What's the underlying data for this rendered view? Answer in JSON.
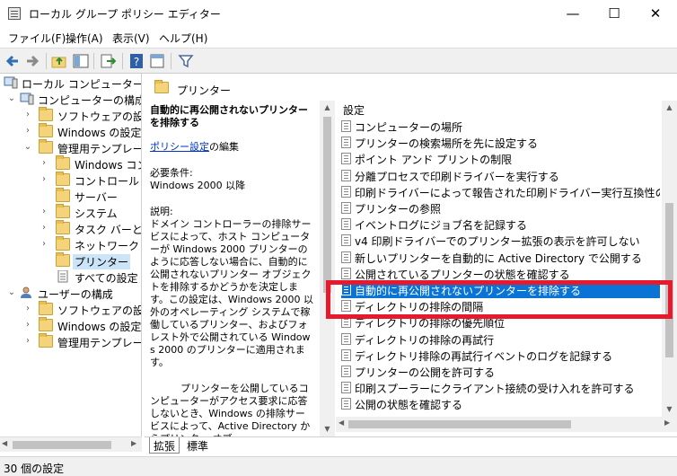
{
  "window": {
    "title": "ローカル グループ ポリシー エディター",
    "minimize": "—",
    "maximize": "☐",
    "close": "✕"
  },
  "menu": {
    "items": [
      "ファイル(F)",
      "操作(A)",
      "表示(V)",
      "ヘルプ(H)"
    ]
  },
  "tree": {
    "items": [
      {
        "label": "ローカル コンピューター ポリシー",
        "icon": "computer-icon",
        "expander": ""
      },
      {
        "label": "コンピューターの構成",
        "icon": "computer-icon",
        "expander": "⌄"
      },
      {
        "label": "ソフトウェアの設定",
        "icon": "folder-icon",
        "expander": "›"
      },
      {
        "label": "Windows の設定",
        "icon": "folder-icon",
        "expander": "›"
      },
      {
        "label": "管理用テンプレート",
        "icon": "folder-icon",
        "expander": "⌄"
      },
      {
        "label": "Windows コンポーネント",
        "icon": "folder-icon",
        "expander": "›"
      },
      {
        "label": "コントロール パネル",
        "icon": "folder-icon",
        "expander": "›"
      },
      {
        "label": "サーバー",
        "icon": "folder-icon",
        "expander": ""
      },
      {
        "label": "システム",
        "icon": "folder-icon",
        "expander": "›"
      },
      {
        "label": "タスク バーと [スタート] メニュー",
        "icon": "folder-icon",
        "expander": "›"
      },
      {
        "label": "ネットワーク",
        "icon": "folder-icon",
        "expander": "›"
      },
      {
        "label": "プリンター",
        "icon": "folder-icon",
        "expander": ""
      },
      {
        "label": "すべての設定",
        "icon": "settings-page-icon",
        "expander": ""
      },
      {
        "label": "ユーザーの構成",
        "icon": "user-icon",
        "expander": "⌄"
      },
      {
        "label": "ソフトウェアの設定",
        "icon": "folder-icon",
        "expander": "›"
      },
      {
        "label": "Windows の設定",
        "icon": "folder-icon",
        "expander": "›"
      },
      {
        "label": "管理用テンプレート",
        "icon": "folder-icon",
        "expander": "›"
      }
    ]
  },
  "right_header": {
    "label": "プリンター"
  },
  "description": {
    "title": "自動的に再公開されないプリンターを排除する",
    "edit_link": "ポリシー設定",
    "edit_suffix": "の編集",
    "req_label": "必要条件:",
    "req_value": "Windows 2000 以降",
    "desc_label": "説明:",
    "desc_text": "ドメイン コントローラーの排除サービスによって、ホスト コンピューターが Windows 2000 プリンターのように応答しない場合に、自動的に公開されないプリンター オブジェクトを排除するかどうかを決定します。この設定は、Windows 2000 以外のオペレーティング システムで稼働しているプリンター、およびフォレスト外で公開されている Windows 2000 のプリンターに適用されます。",
    "desc_text2": "プリンターを公開しているコンピューターがアクセス要求に応答しないとき、Windows の排除サービスによって、Active Directory からプリンター オブ"
  },
  "list": {
    "header": "設定",
    "items": [
      "コンピューターの場所",
      "プリンターの検索場所を先に設定する",
      "ポイント アンド プリントの制限",
      "分離プロセスで印刷ドライバーを実行する",
      "印刷ドライバーによって報告された印刷ドライバー実行互換性の設定...",
      "プリンターの参照",
      "イベントログにジョブ名を記録する",
      "v4 印刷ドライバーでのプリンター拡張の表示を許可しない",
      "新しいプリンターを自動的に Active Directory で公開する",
      "公開されているプリンターの状態を確認する",
      "自動的に再公開されないプリンターを排除する",
      "ディレクトリの排除の間隔",
      "ディレクトリの排除の優先順位",
      "ディレクトリの排除の再試行",
      "ディレクトリ排除の再試行イベントのログを記録する",
      "プリンターの公開を許可する",
      "印刷スプーラーにクライアント接続の受け入れを許可する",
      "公開の状態を確認する"
    ],
    "selected_index": 10
  },
  "tabs": [
    "拡張",
    "標準"
  ],
  "status": {
    "text": "30 個の設定"
  },
  "colors": {
    "selection": "#0a74d6",
    "highlight_box": "#e8192d",
    "link": "#0033cc"
  }
}
